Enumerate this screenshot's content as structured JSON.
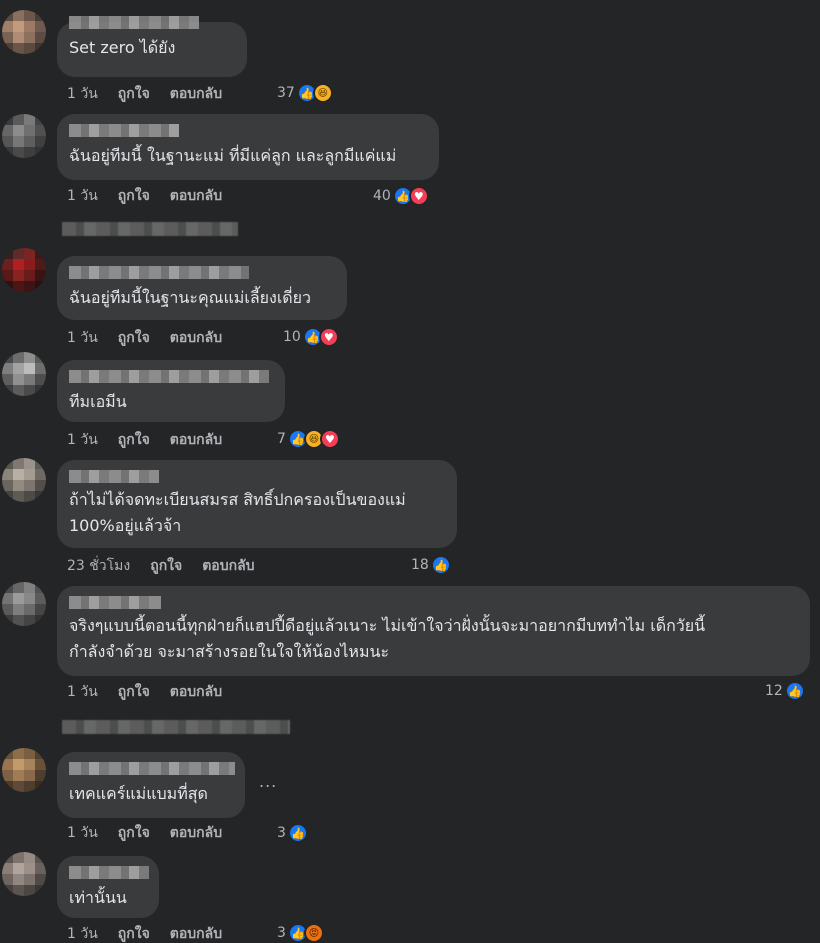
{
  "comments": [
    {
      "text": "Set zero ได้ยัง",
      "time": "1 วัน",
      "like_label": "ถูกใจ",
      "reply_label": "ตอบกลับ",
      "reaction_count": "37",
      "reactions": [
        "like-icon",
        "haha-icon"
      ]
    },
    {
      "text": "ฉันอยู่ทีมนี้ ในฐานะแม่ ที่มีแค่ลูก และลูกมีแค่แม่",
      "time": "1 วัน",
      "like_label": "ถูกใจ",
      "reply_label": "ตอบกลับ",
      "reaction_count": "40",
      "reactions": [
        "like-icon",
        "love-icon"
      ]
    },
    {
      "text": "ฉันอยู่ทีมนี้ในฐานะคุณแม่เลี้ยงเดี่ยว",
      "time": "1 วัน",
      "like_label": "ถูกใจ",
      "reply_label": "ตอบกลับ",
      "reaction_count": "10",
      "reactions": [
        "like-icon",
        "love-icon"
      ]
    },
    {
      "text": "ทีมเอมีน",
      "time": "1 วัน",
      "like_label": "ถูกใจ",
      "reply_label": "ตอบกลับ",
      "reaction_count": "7",
      "reactions": [
        "like-icon",
        "haha-icon",
        "love-icon"
      ]
    },
    {
      "text": "ถ้าไม่ได้จดทะเบียนสมรส สิทธิ์ปกครองเป็นของแม่\n100%อยู่แล้วจ้า",
      "time": "23 ชั่วโมง",
      "like_label": "ถูกใจ",
      "reply_label": "ตอบกลับ",
      "reaction_count": "18",
      "reactions": [
        "like-icon"
      ]
    },
    {
      "text": "จริงๆแบบนี้ตอนนี้ทุกฝ่ายก็แฮปปี้ดีอยู่แล้วเนาะ ไม่เข้าใจว่าฝั่งนั้นจะมาอยากมีบททำไม เด็กวัยนี้\nกำลังจำด้วย จะมาสร้างรอยในใจให้น้องไหมนะ",
      "time": "1 วัน",
      "like_label": "ถูกใจ",
      "reply_label": "ตอบกลับ",
      "reaction_count": "12",
      "reactions": [
        "like-icon"
      ]
    },
    {
      "text": "เทคแคร์แม่แบมที่สุด",
      "time": "1 วัน",
      "like_label": "ถูกใจ",
      "reply_label": "ตอบกลับ",
      "reaction_count": "3",
      "reactions": [
        "like-icon"
      ]
    },
    {
      "text": "เท่านั้นน",
      "time": "1 วัน",
      "like_label": "ถูกใจ",
      "reply_label": "ตอบกลับ",
      "reaction_count": "3",
      "reactions": [
        "like-icon",
        "angry-icon"
      ]
    }
  ],
  "more_options_label": "...",
  "colors": {
    "background": "#242526",
    "bubble": "#3a3b3c",
    "text": "#e4e6eb",
    "secondary_text": "#b0b3b8",
    "like_blue": "#1877f2",
    "love_red": "#f33e58"
  }
}
